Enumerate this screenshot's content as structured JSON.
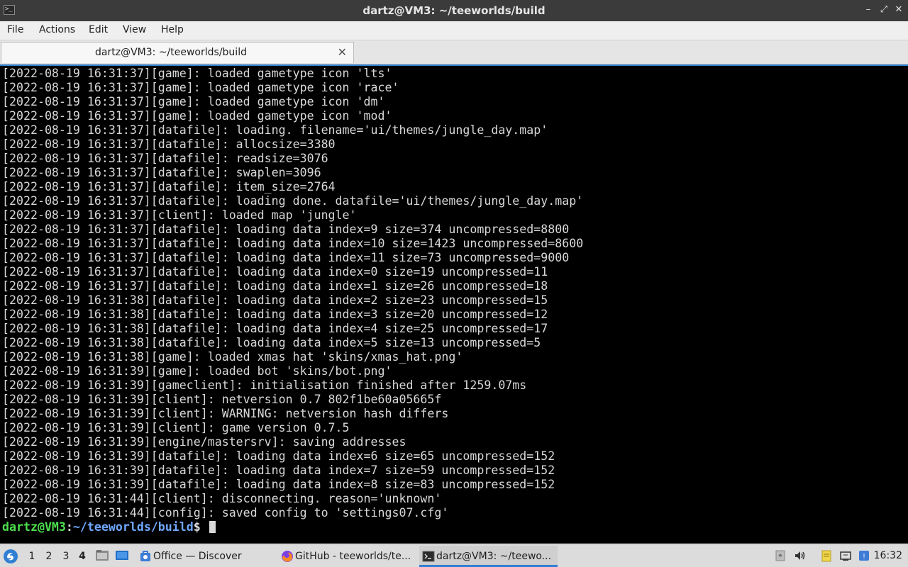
{
  "window": {
    "title": "dartz@VM3: ~/teeworlds/build",
    "controls": {
      "minimize": "–",
      "maximize": "⤢",
      "close": "✕"
    }
  },
  "menu": [
    "File",
    "Actions",
    "Edit",
    "View",
    "Help"
  ],
  "tab": {
    "label": "dartz@VM3: ~/teeworlds/build",
    "close": "✕"
  },
  "terminal": {
    "lines": [
      "[2022-08-19 16:31:37][game]: loaded gametype icon 'lts'",
      "[2022-08-19 16:31:37][game]: loaded gametype icon 'race'",
      "[2022-08-19 16:31:37][game]: loaded gametype icon 'dm'",
      "[2022-08-19 16:31:37][game]: loaded gametype icon 'mod'",
      "[2022-08-19 16:31:37][datafile]: loading. filename='ui/themes/jungle_day.map'",
      "[2022-08-19 16:31:37][datafile]: allocsize=3380",
      "[2022-08-19 16:31:37][datafile]: readsize=3076",
      "[2022-08-19 16:31:37][datafile]: swaplen=3096",
      "[2022-08-19 16:31:37][datafile]: item_size=2764",
      "[2022-08-19 16:31:37][datafile]: loading done. datafile='ui/themes/jungle_day.map'",
      "[2022-08-19 16:31:37][client]: loaded map 'jungle'",
      "[2022-08-19 16:31:37][datafile]: loading data index=9 size=374 uncompressed=8800",
      "[2022-08-19 16:31:37][datafile]: loading data index=10 size=1423 uncompressed=8600",
      "[2022-08-19 16:31:37][datafile]: loading data index=11 size=73 uncompressed=9000",
      "[2022-08-19 16:31:37][datafile]: loading data index=0 size=19 uncompressed=11",
      "[2022-08-19 16:31:37][datafile]: loading data index=1 size=26 uncompressed=18",
      "[2022-08-19 16:31:38][datafile]: loading data index=2 size=23 uncompressed=15",
      "[2022-08-19 16:31:38][datafile]: loading data index=3 size=20 uncompressed=12",
      "[2022-08-19 16:31:38][datafile]: loading data index=4 size=25 uncompressed=17",
      "[2022-08-19 16:31:38][datafile]: loading data index=5 size=13 uncompressed=5",
      "[2022-08-19 16:31:38][game]: loaded xmas hat 'skins/xmas_hat.png'",
      "[2022-08-19 16:31:39][game]: loaded bot 'skins/bot.png'",
      "[2022-08-19 16:31:39][gameclient]: initialisation finished after 1259.07ms",
      "[2022-08-19 16:31:39][client]: netversion 0.7 802f1be60a05665f",
      "[2022-08-19 16:31:39][client]: WARNING: netversion hash differs",
      "[2022-08-19 16:31:39][client]: game version 0.7.5",
      "[2022-08-19 16:31:39][engine/mastersrv]: saving addresses",
      "[2022-08-19 16:31:39][datafile]: loading data index=6 size=65 uncompressed=152",
      "[2022-08-19 16:31:39][datafile]: loading data index=7 size=59 uncompressed=152",
      "[2022-08-19 16:31:39][datafile]: loading data index=8 size=83 uncompressed=152",
      "[2022-08-19 16:31:44][client]: disconnecting. reason='unknown'",
      "[2022-08-19 16:31:44][config]: saved config to 'settings07.cfg'"
    ],
    "prompt": {
      "user_host": "dartz@VM3",
      "colon": ":",
      "path": "~/teeworlds/build",
      "dollar": "$ "
    }
  },
  "taskbar": {
    "workspaces": [
      "1",
      "2",
      "3",
      "4"
    ],
    "active_workspace": "4",
    "tasks": [
      {
        "label": "Office — Discover",
        "icon": "discover-icon"
      },
      {
        "label": "GitHub - teeworlds/te...",
        "icon": "firefox-icon"
      },
      {
        "label": "dartz@VM3: ~/teewo...",
        "icon": "terminal-icon"
      }
    ],
    "clock": "16:32"
  },
  "colors": {
    "terminal_bg": "#000000",
    "terminal_fg": "#d8d8d8",
    "prompt_user": "#4ee04e",
    "prompt_path": "#6fa8ff",
    "accent": "#2f7fd3"
  }
}
